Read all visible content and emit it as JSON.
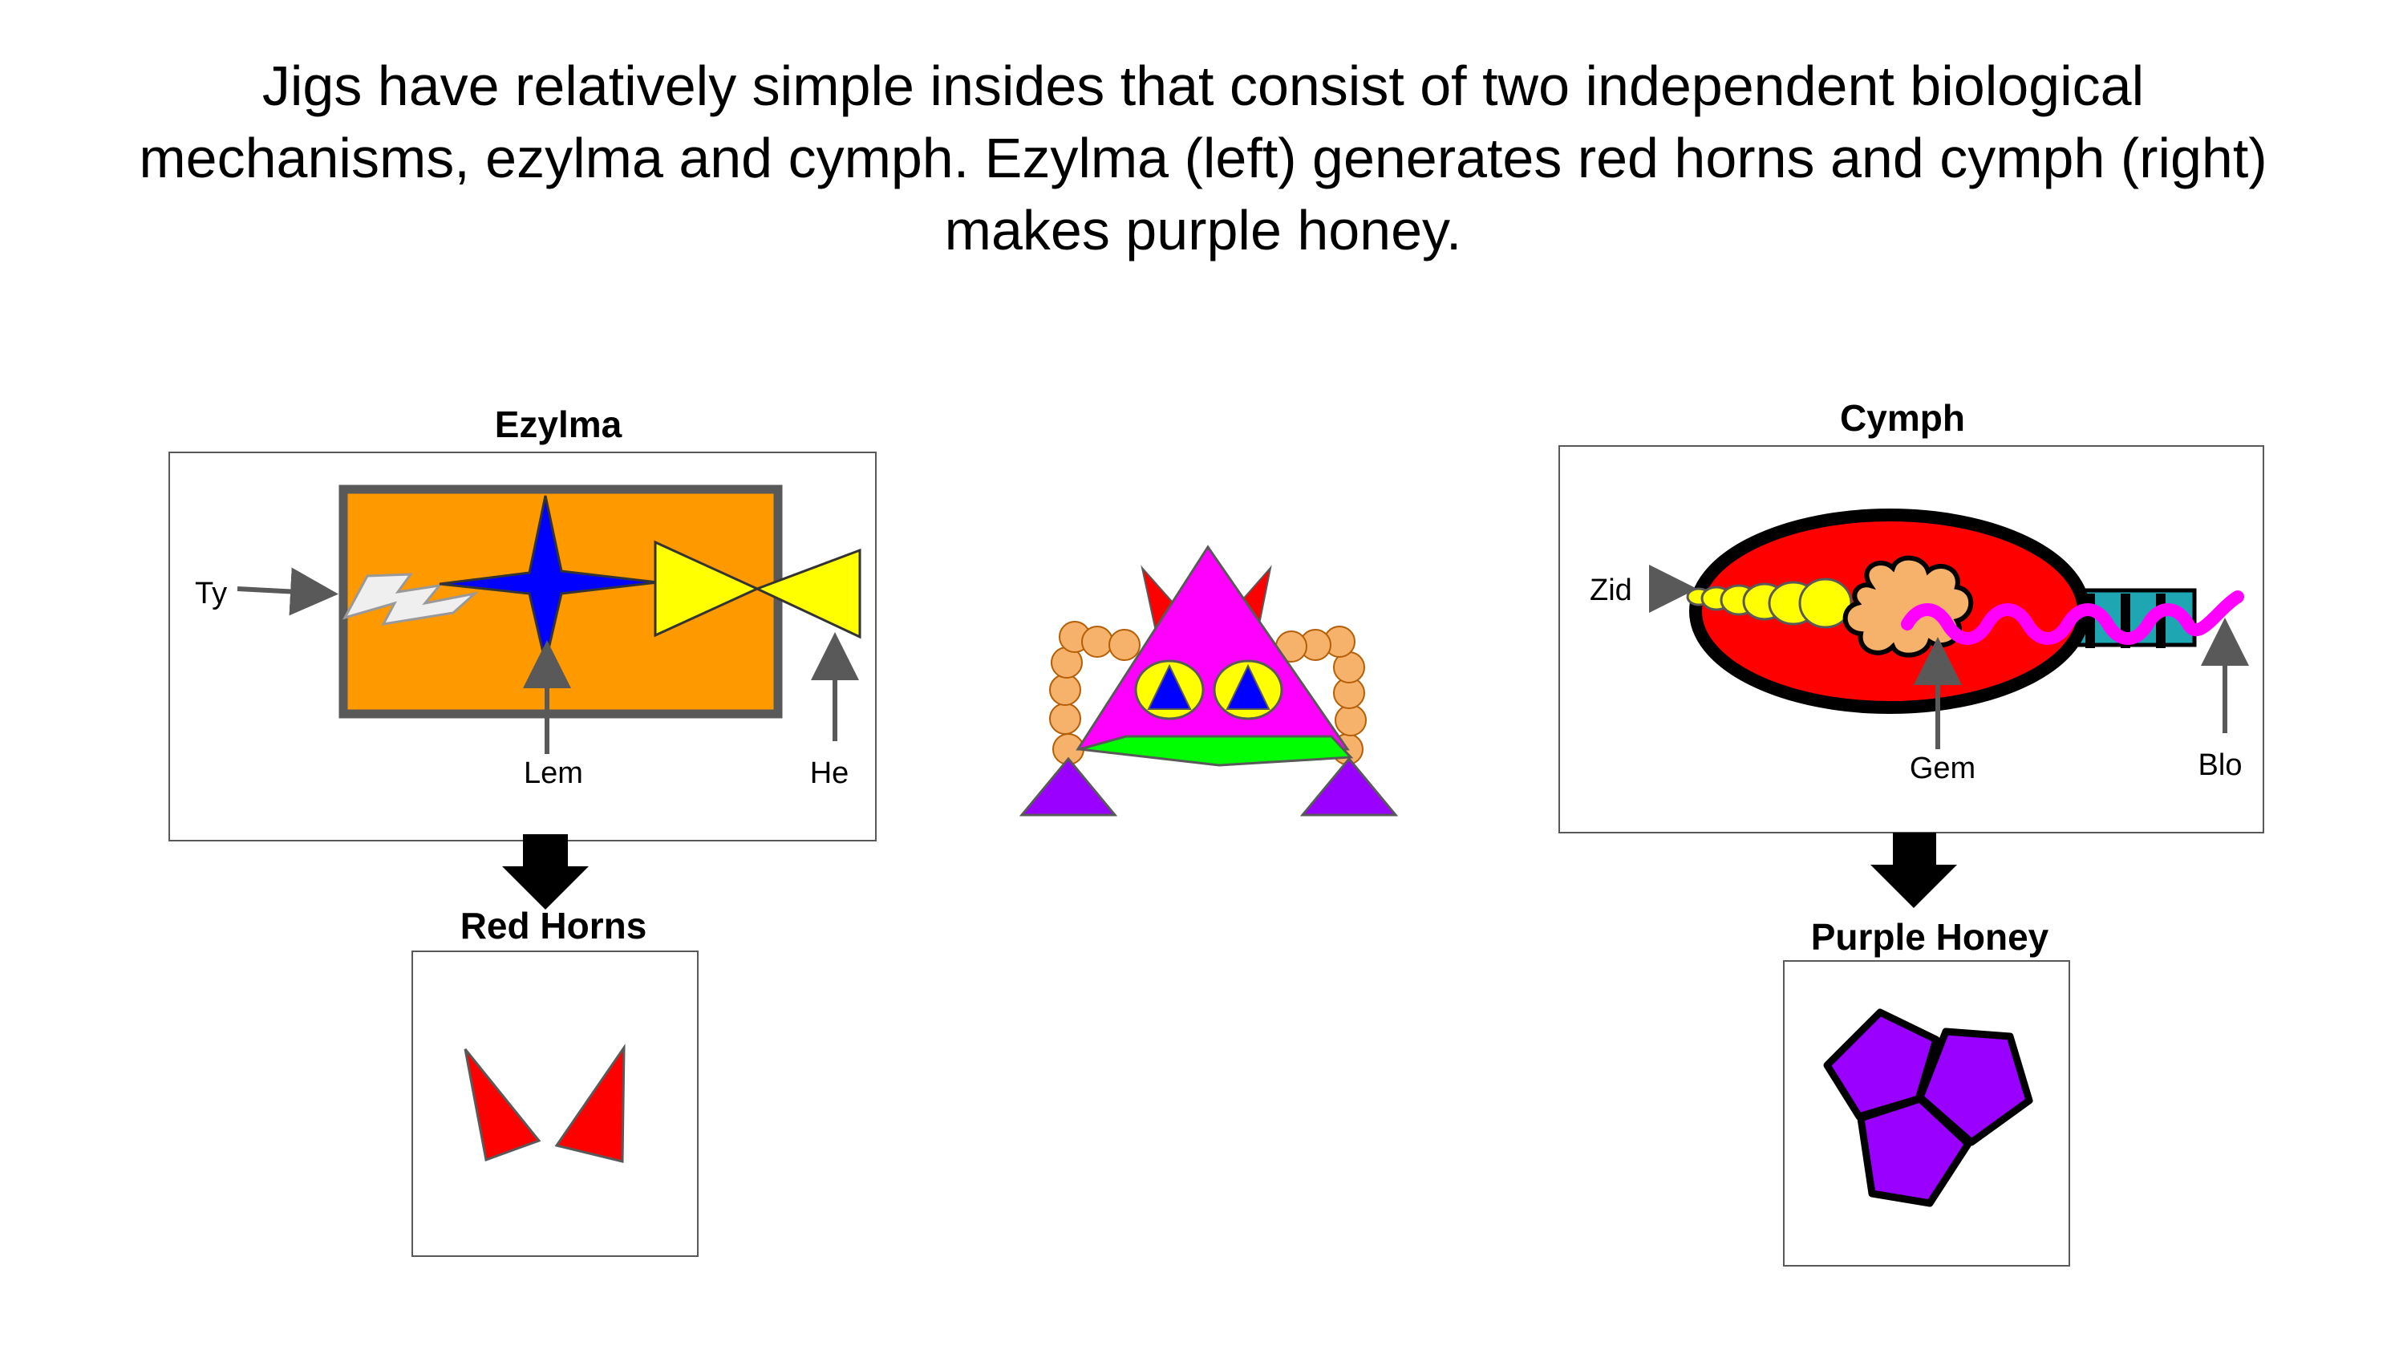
{
  "headline": "Jigs have relatively simple insides that consist of two independent biological mechanisms, ezylma and cymph. Ezylma (left) generates red horns and cymph (right) makes purple honey.",
  "ezylma": {
    "title": "Ezylma",
    "labels": {
      "ty": "Ty",
      "lem": "Lem",
      "he": "He"
    },
    "product": "Red Horns"
  },
  "cymph": {
    "title": "Cymph",
    "labels": {
      "zid": "Zid",
      "gem": "Gem",
      "blo": "Blo"
    },
    "product": "Purple Honey"
  },
  "colors": {
    "orange_box": "#ff9900",
    "frame_grey": "#595959",
    "star_blue": "#0000ff",
    "bowtie_yellow": "#ffff00",
    "horn_red": "#ff0000",
    "magenta": "#ff00ff",
    "purple": "#9900ff",
    "green": "#00ff00",
    "bead_orange": "#f6b26b",
    "teal": "#1ea6b3"
  }
}
